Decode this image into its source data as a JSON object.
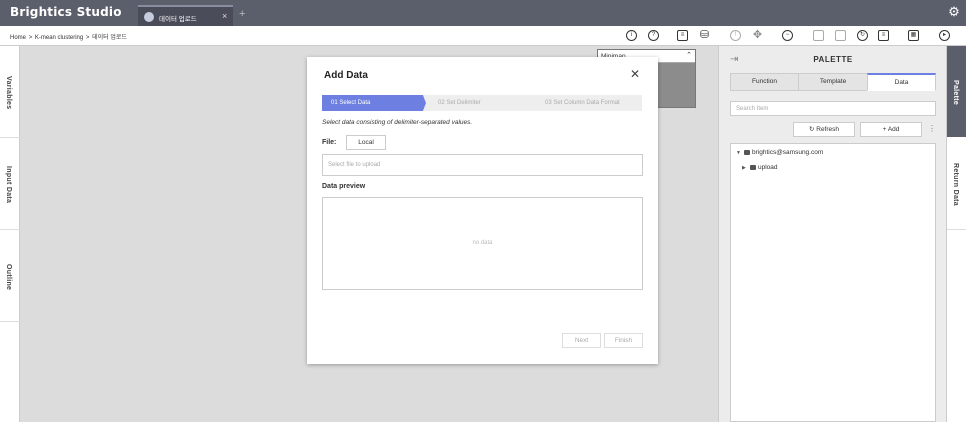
{
  "app": {
    "brand": "Brightics Studio"
  },
  "tabs": [
    {
      "label": "데이터 업로드",
      "close": "×"
    }
  ],
  "tab_add": "+",
  "toolbar": {
    "breadcrumb": [
      "Home",
      ">",
      "K-mean clustering",
      ">",
      "데이터 업로드"
    ],
    "icons": [
      "info-icon",
      "help-icon",
      "notebook-icon",
      "model-icon",
      "warning-icon",
      "move-icon",
      "zoom-icon",
      "copy-icon",
      "paste-icon",
      "refresh-icon",
      "clipboard-icon",
      "calendar-icon",
      "run-icon"
    ]
  },
  "left_rail": {
    "items": [
      "Variables",
      "Input Data",
      "Outline"
    ]
  },
  "minimap": {
    "label": "Minimap",
    "toggle": "⌃"
  },
  "modal": {
    "title": "Add Data",
    "close": "✕",
    "steps": [
      "01 Select Data",
      "02 Set Delimiter",
      "03 Set Column Data Format"
    ],
    "active_step": 0,
    "description": "Select data consisting of delimiter-separated values.",
    "file_label": "File:",
    "local_button": "Local",
    "file_placeholder": "Select file to upload",
    "preview_label": "Data preview",
    "no_data": "no data",
    "next": "Next",
    "finish": "Finish"
  },
  "palette": {
    "title": "PALETTE",
    "tabs": [
      "Function",
      "Template",
      "Data"
    ],
    "active_tab": "Data",
    "search_placeholder": "Search Item",
    "refresh": "Refresh",
    "add": "Add",
    "more": "⋮",
    "tree": [
      {
        "label": "brightics@samsung.com",
        "expanded": true
      },
      {
        "label": "upload",
        "expanded": false
      }
    ]
  },
  "right_rail": {
    "items": [
      "Palette",
      "Return Data"
    ],
    "active": "Palette"
  },
  "colors": {
    "titlebar": "#5b5e6b",
    "accent": "#6d7fe0"
  }
}
